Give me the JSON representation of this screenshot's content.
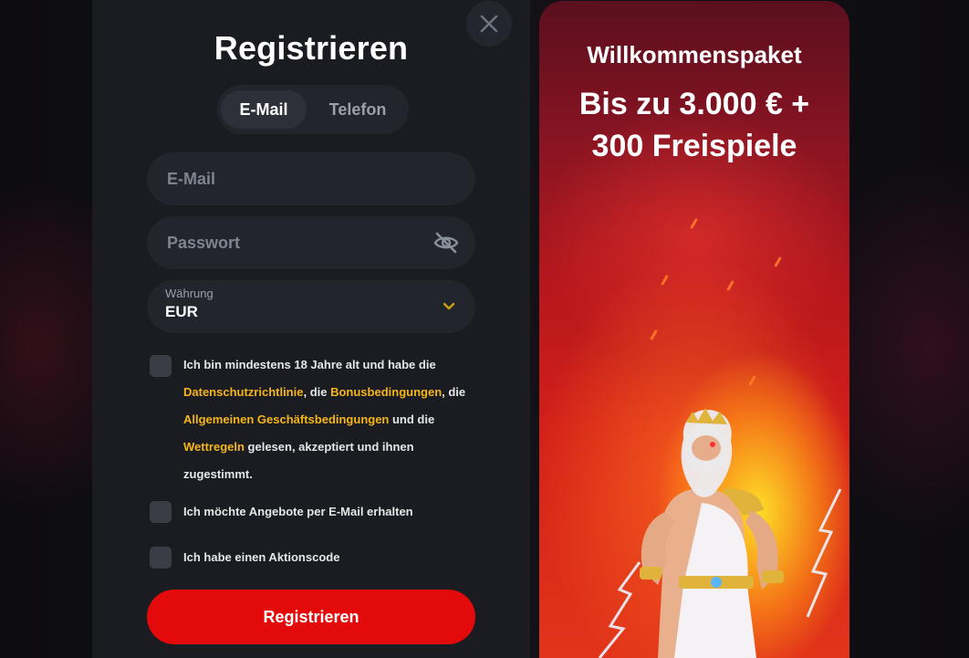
{
  "registration": {
    "title": "Registrieren",
    "tabs": [
      {
        "label": "E-Mail",
        "active": true
      },
      {
        "label": "Telefon",
        "active": false
      }
    ],
    "email_placeholder": "E-Mail",
    "password_placeholder": "Passwort",
    "currency": {
      "label": "Währung",
      "value": "EUR"
    },
    "consent": {
      "text_1": "Ich bin mindestens 18 Jahre alt und habe die ",
      "link_privacy": "Datenschutzrichtlinie",
      "text_2": ", die ",
      "link_bonus": "Bonusbedingungen",
      "text_3": ", die ",
      "link_terms": "Allgemeinen Geschäftsbedingungen",
      "text_4": " und die ",
      "link_betting": "Wettregeln",
      "text_5": " gelesen, akzeptiert und ihnen zugestimmt."
    },
    "newsletter_label": "Ich möchte Angebote per E-Mail erhalten",
    "promo_code_label": "Ich habe einen Aktionscode",
    "submit_label": "Registrieren"
  },
  "promo": {
    "title": "Willkommenspaket",
    "offer_line1": "Bis zu 3.000 € +",
    "offer_line2": "300 Freispiele"
  },
  "icons": {
    "close": "close-icon",
    "password_toggle": "eye-slash-icon",
    "currency_dropdown": "chevron-down-icon"
  },
  "colors": {
    "accent_red": "#e20a0a",
    "link_yellow": "#f5b518",
    "modal_bg": "#1a1c22",
    "field_bg": "#22252c"
  }
}
